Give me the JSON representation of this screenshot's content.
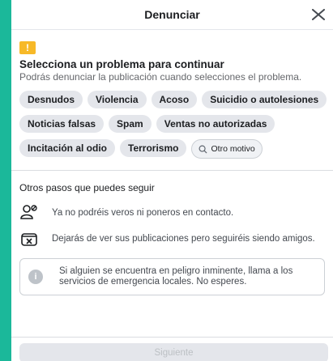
{
  "dialog": {
    "title": "Denunciar",
    "close_icon": "close-icon"
  },
  "prompt": {
    "warning_icon": "!",
    "heading": "Selecciona un problema para continuar",
    "subtitle": "Podrás denunciar la publicación cuando selecciones el problema."
  },
  "problems": [
    "Desnudos",
    "Violencia",
    "Acoso",
    "Suicidio o autolesiones",
    "Noticias falsas",
    "Spam",
    "Ventas no autorizadas",
    "Incitación al odio",
    "Terrorismo"
  ],
  "other_option": {
    "label": "Otro motivo",
    "icon": "search-icon"
  },
  "other_steps": {
    "title": "Otros pasos que puedes seguir",
    "items": [
      {
        "icon": "unfriend-icon",
        "text": "Ya no podréis veros ni poneros en contacto."
      },
      {
        "icon": "unfollow-icon",
        "text": "Dejarás de ver sus publicaciones pero seguiréis siendo amigos."
      }
    ]
  },
  "notice": {
    "icon": "info-icon",
    "symbol": "i",
    "text": "Si alguien se encuentra en peligro inminente, llama a los servicios de emergencia locales. No esperes."
  },
  "footer": {
    "next_label": "Siguiente"
  },
  "colors": {
    "background": "#1bb89a",
    "warning": "#f7b928",
    "chip": "#e4e6eb"
  }
}
